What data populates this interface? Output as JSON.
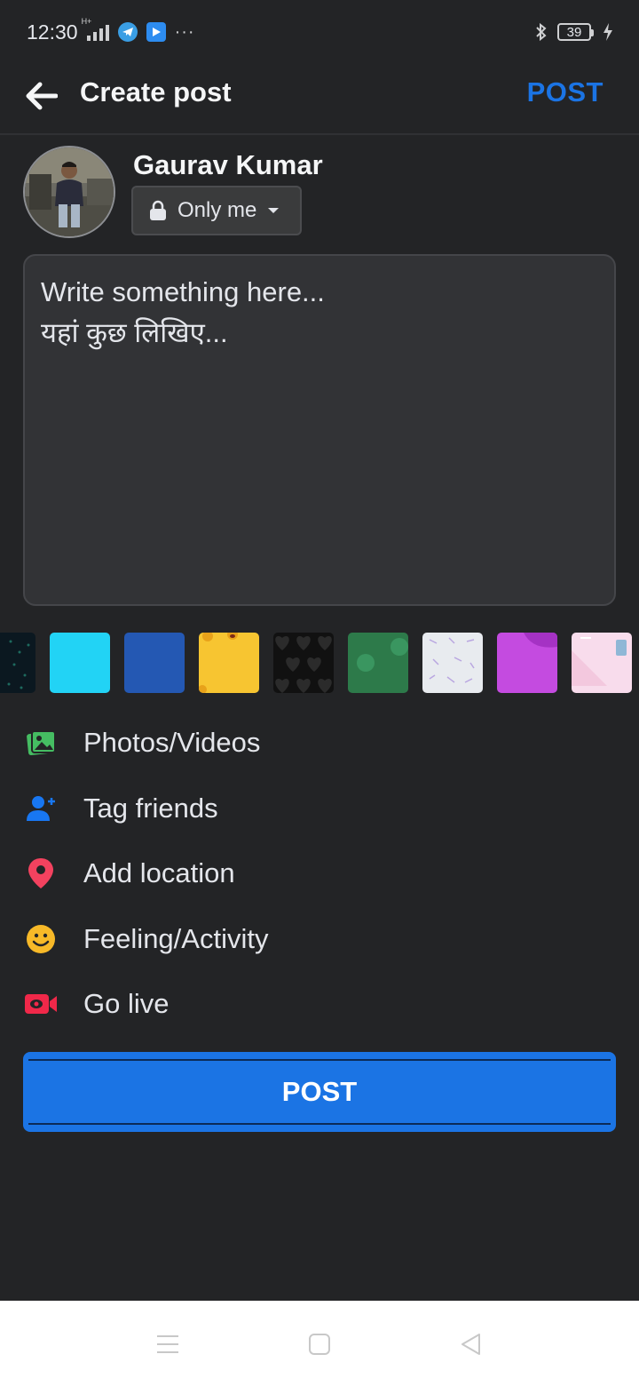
{
  "status": {
    "time": "12:30",
    "signal_label": "H+",
    "battery": "39"
  },
  "header": {
    "title": "Create post",
    "post_label": "POST"
  },
  "profile": {
    "name": "Gaurav Kumar",
    "privacy": "Only me"
  },
  "composer": {
    "placeholder_line1": "Write something here...",
    "placeholder_line2": "यहां कुछ लिखिए..."
  },
  "backgrounds": [
    {
      "name": "dark-dots",
      "color": "#0b1820"
    },
    {
      "name": "cyan",
      "color": "#22d3f5"
    },
    {
      "name": "blue",
      "color": "#2458b3"
    },
    {
      "name": "yellow-emoji",
      "color": "#f7c531"
    },
    {
      "name": "black-hearts",
      "color": "#111111"
    },
    {
      "name": "green",
      "color": "#2d7a4a"
    },
    {
      "name": "light-pattern",
      "color": "#e8ebef"
    },
    {
      "name": "purple",
      "color": "#c44be0"
    },
    {
      "name": "pink",
      "color": "#f8dcec"
    }
  ],
  "actions": [
    {
      "label": "Photos/Videos",
      "icon": "photo-icon",
      "color": "#45bd62"
    },
    {
      "label": "Tag friends",
      "icon": "tag-friend-icon",
      "color": "#1877f2"
    },
    {
      "label": "Add location",
      "icon": "location-pin-icon",
      "color": "#f3425f"
    },
    {
      "label": "Feeling/Activity",
      "icon": "smiley-icon",
      "color": "#f7b928"
    },
    {
      "label": "Go live",
      "icon": "live-video-icon",
      "color": "#f02849"
    }
  ],
  "post_button": "POST",
  "colors": {
    "accent": "#1b74e4",
    "background": "#232426"
  }
}
